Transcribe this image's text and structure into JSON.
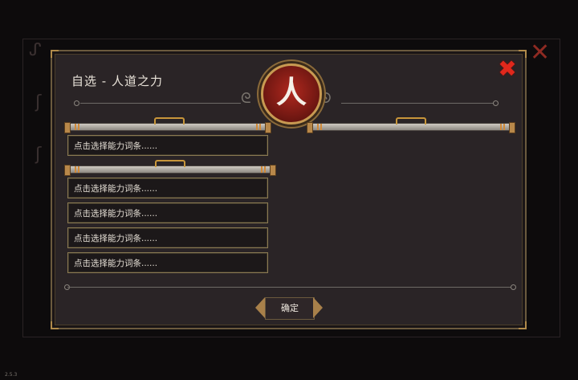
{
  "dialog": {
    "title": "自选 - 人道之力",
    "emblem_char": "人",
    "close_symbol": "✖"
  },
  "slots_top": [
    {
      "text": "点击选择能力词条......"
    }
  ],
  "slots_bottom": [
    {
      "text": "点击选择能力词条......"
    },
    {
      "text": "点击选择能力词条......"
    },
    {
      "text": "点击选择能力词条......"
    },
    {
      "text": "点击选择能力词条......"
    }
  ],
  "confirm_label": "确定",
  "version": "2.5.3",
  "colors": {
    "panel": "#2a2426",
    "gold_border": "#8a7a52",
    "close_red": "#e0281c",
    "emblem_red": "#7a1a14"
  }
}
